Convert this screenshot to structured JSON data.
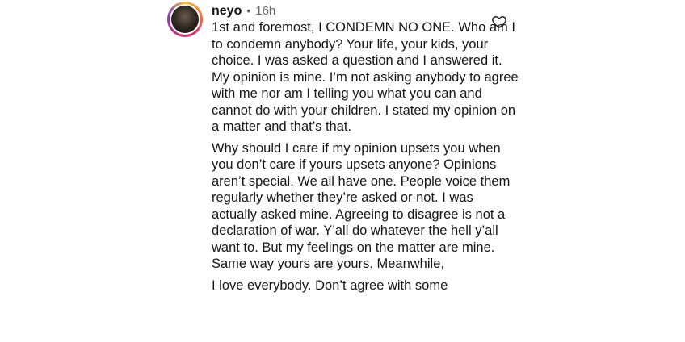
{
  "comment": {
    "username": "neyo",
    "separator": "•",
    "time": "16h",
    "paragraphs": [
      "1st and foremost, I CONDEMN NO ONE. Who am I to condemn anybody? Your life, your kids, your choice. I was asked a question and I answered it. My opinion is mine. I’m not asking anybody to agree with me nor am I telling you what you can and cannot do with your children. I stated my opinion on a matter and that’s that.",
      "Why should I care if my opinion upsets you when you don’t care if yours upsets anyone? Opinions aren’t special. We all have one. People voice them regularly whether they’re asked or not. I was actually asked mine. Agreeing to disagree is not a declaration of war. Y’all do whatever the hell y’all want to. But my feelings on the matter are mine. Same way yours are yours. Meanwhile,",
      "I love everybody. Don’t agree with some"
    ]
  },
  "icons": {
    "like": "heart-outline-icon",
    "avatar_ring_colors": [
      "#f9c03a",
      "#f77737",
      "#e1306c",
      "#c13584",
      "#833ab4"
    ]
  }
}
